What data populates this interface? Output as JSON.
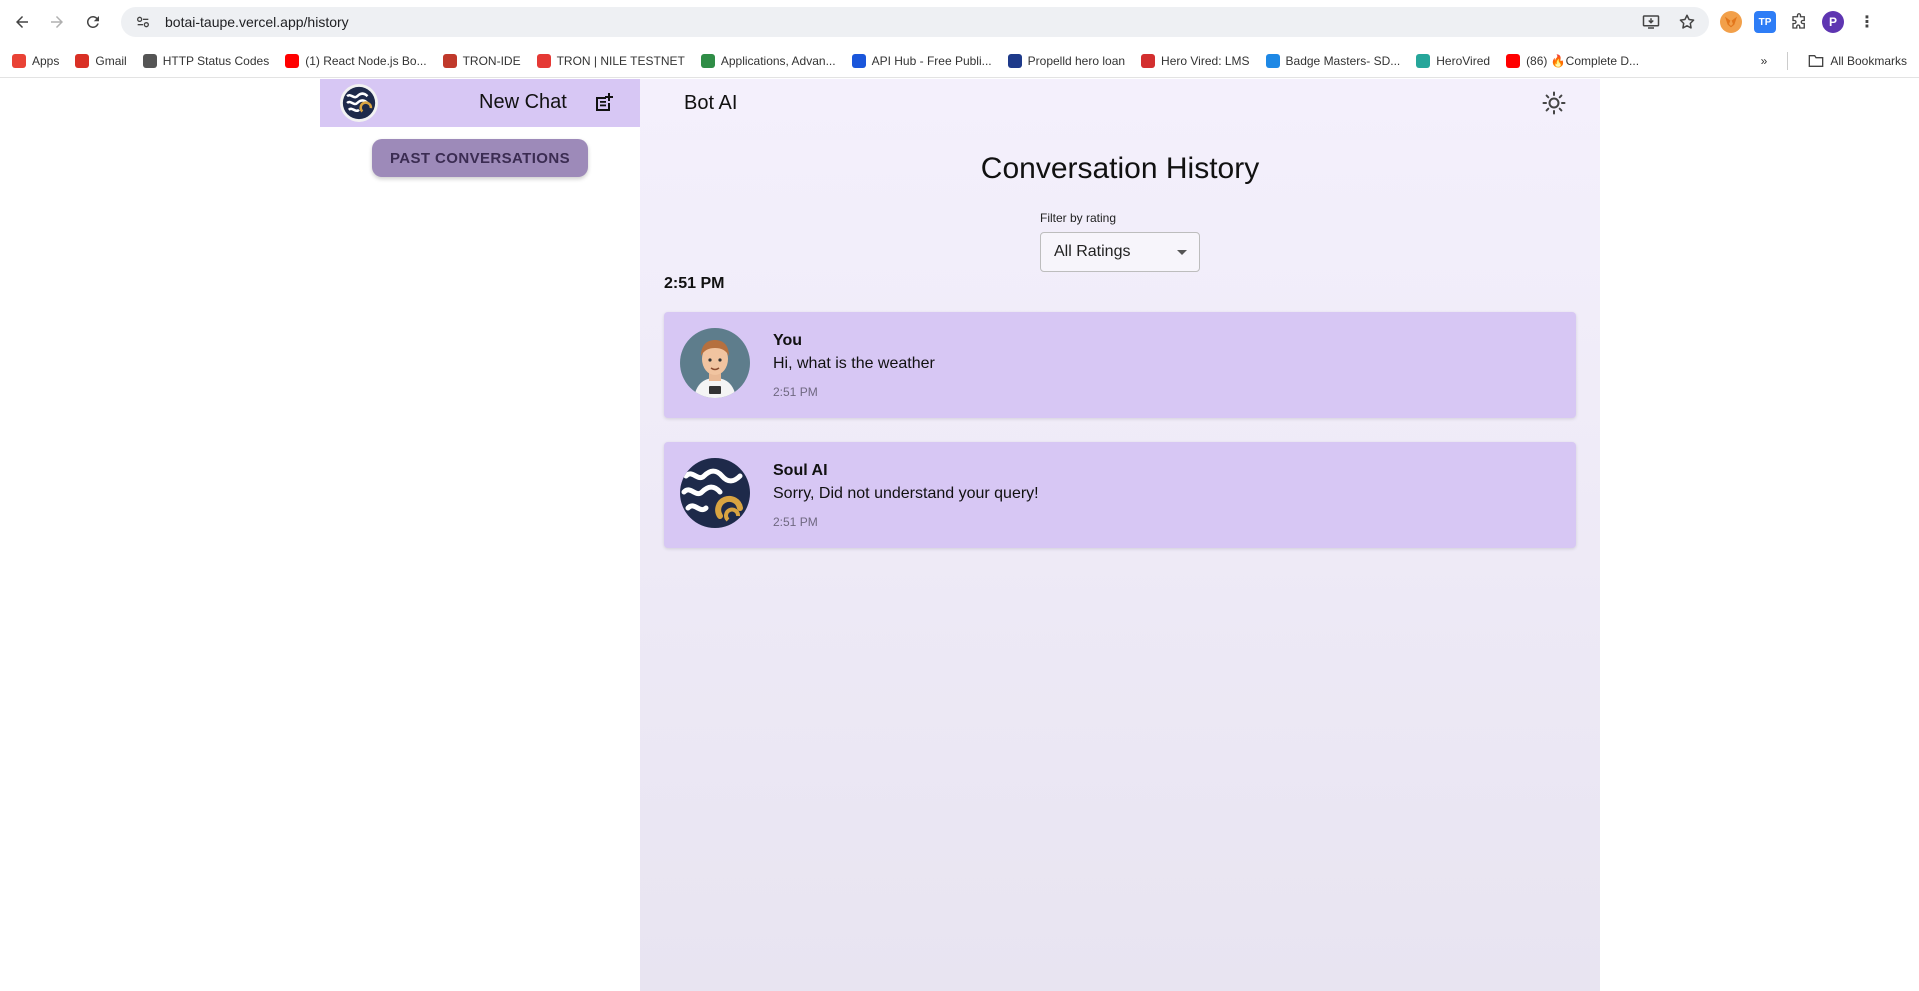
{
  "browser": {
    "url": "botai-taupe.vercel.app/history",
    "bookmarks": [
      {
        "label": "Apps",
        "icon": "apps-grid-icon",
        "color": "#e94235"
      },
      {
        "label": "Gmail",
        "icon": "gmail-icon",
        "color": "#d93025"
      },
      {
        "label": "HTTP Status Codes",
        "icon": "globe-icon",
        "color": "#555555"
      },
      {
        "label": "(1) React Node.js Bo...",
        "icon": "youtube-icon",
        "color": "#ff0000"
      },
      {
        "label": "TRON-IDE",
        "icon": "tron-ide-icon",
        "color": "#c0392b"
      },
      {
        "label": "TRON | NILE TESTNET",
        "icon": "tron-icon",
        "color": "#e53935"
      },
      {
        "label": "Applications, Advan...",
        "icon": "gfg-icon",
        "color": "#2f8d46"
      },
      {
        "label": "API Hub - Free Publi...",
        "icon": "api-hub-icon",
        "color": "#1a56db"
      },
      {
        "label": "Propelld hero loan",
        "icon": "propelld-icon",
        "color": "#1e3a8a"
      },
      {
        "label": "Hero Vired: LMS",
        "icon": "herovired-icon",
        "color": "#d32f2f"
      },
      {
        "label": "Badge Masters- SD...",
        "icon": "drop-icon",
        "color": "#1e88e5"
      },
      {
        "label": "HeroVired",
        "icon": "herovired-q-icon",
        "color": "#26a69a"
      },
      {
        "label": "(86) 🔥Complete D...",
        "icon": "youtube-icon",
        "color": "#ff0000"
      }
    ],
    "all_bookmarks_label": "All Bookmarks",
    "profile_initial": "P",
    "tp_label": "TP"
  },
  "sidebar": {
    "new_chat_label": "New Chat",
    "past_conversations_label": "PAST CONVERSATIONS"
  },
  "main": {
    "brand": "Bot AI",
    "title": "Conversation History",
    "filter_label": "Filter by rating",
    "filter_value": "All Ratings",
    "group_time": "2:51 PM",
    "messages": [
      {
        "name": "You",
        "text": "Hi, what is the weather",
        "time": "2:51 PM"
      },
      {
        "name": "Soul AI",
        "text": "Sorry, Did not understand your query!",
        "time": "2:51 PM"
      }
    ]
  },
  "colors": {
    "accent": "#d7c7f4",
    "past_button": "#9d8ab9"
  }
}
